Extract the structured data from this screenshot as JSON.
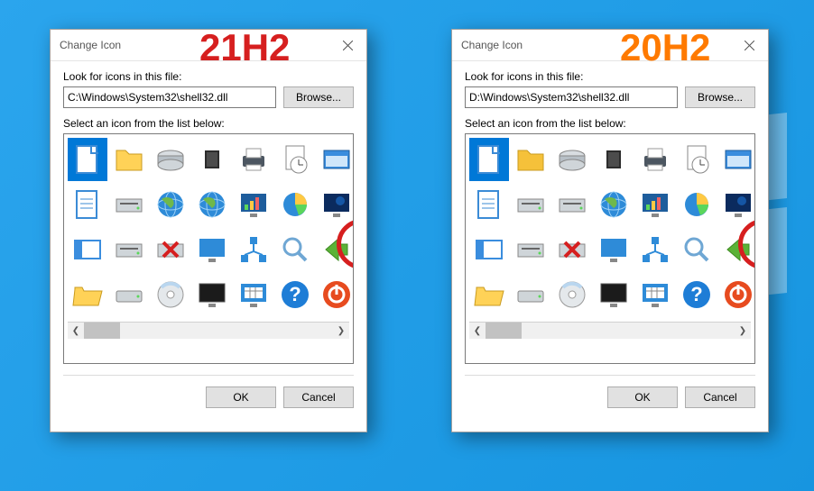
{
  "dialogs": [
    {
      "id": "d21h2",
      "title": "Change Icon",
      "version_label": "21H2",
      "look_label": "Look for icons in this file:",
      "path": "C:\\Windows\\System32\\shell32.dll",
      "browse": "Browse...",
      "select_label": "Select an icon from the list below:",
      "ok": "OK",
      "cancel": "Cancel"
    },
    {
      "id": "d20h2",
      "title": "Change Icon",
      "version_label": "20H2",
      "look_label": "Look for icons in this file:",
      "path": "D:\\Windows\\System32\\shell32.dll",
      "browse": "Browse...",
      "select_label": "Select an icon from the list below:",
      "ok": "OK",
      "cancel": "Cancel"
    }
  ],
  "icons_21h2": [
    "blank-document",
    "folder",
    "hard-drive-top",
    "chip",
    "printer",
    "clock-document",
    "window-run",
    "text-document",
    "drive-bay",
    "globe-blue",
    "globe-shaded",
    "monitor-chart",
    "pie-chart",
    "monitor-night",
    "window-sidebar",
    "drive-slot",
    "drive-red-x",
    "monitor",
    "network-nodes",
    "magnifier",
    "arrow-back-green",
    "folder-open",
    "hard-drive",
    "optical-disc",
    "monitor-off",
    "monitor-calendar",
    "help-circle",
    "power-circle"
  ],
  "icons_20h2": [
    "blank-document",
    "folder",
    "hard-drive-3d",
    "chip-3d",
    "printer-3d",
    "clock-document",
    "window-run",
    "text-document",
    "drive-bay-3d",
    "drive-light",
    "globe-ie",
    "monitor-chart",
    "pie-chart",
    "monitor-box",
    "window-blank",
    "floppy-drive",
    "drive-red-x",
    "monitor",
    "network-nodes",
    "magnifier",
    "arrow-back-green",
    "folder-open",
    "hard-drive",
    "optical-disc",
    "monitor-off",
    "monitor-calendar",
    "help-circle",
    "power-circle"
  ]
}
